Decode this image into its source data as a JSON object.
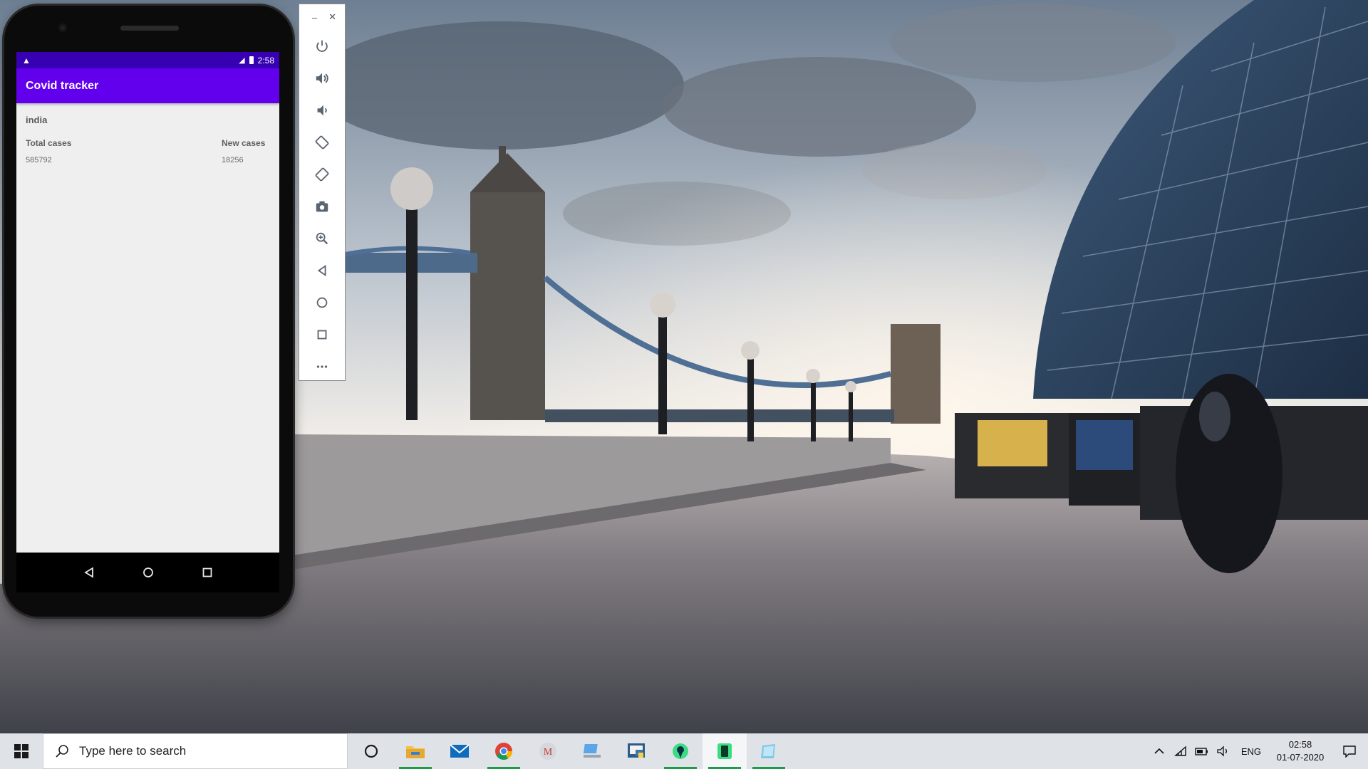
{
  "emulator": {
    "status_bar": {
      "time": "2:58"
    },
    "app": {
      "title": "Covid tracker",
      "country": "india",
      "stats": [
        {
          "label": "Total cases",
          "value": "585792"
        },
        {
          "label": "New cases",
          "value": "18256"
        }
      ]
    },
    "nav_buttons": [
      "back-icon",
      "home-icon",
      "overview-icon"
    ],
    "toolbar": {
      "window_controls": [
        "minimize-icon",
        "close-icon"
      ],
      "buttons": [
        "power-icon",
        "volume-up-icon",
        "volume-down-icon",
        "rotate-left-icon",
        "rotate-right-icon",
        "camera-icon",
        "zoom-icon",
        "back-icon",
        "home-icon",
        "overview-icon",
        "more-icon"
      ]
    }
  },
  "taskbar": {
    "search_placeholder": "Type here to search",
    "pinned_icons": [
      "cortana-icon",
      "file-explorer-icon",
      "mail-icon",
      "chrome-icon",
      "gmail-icon",
      "network-drive-icon",
      "python-icon",
      "android-studio-icon",
      "emulator-icon",
      "notepad-icon"
    ],
    "tray": {
      "language": "ENG",
      "time": "02:58",
      "date": "01-07-2020"
    }
  },
  "colors": {
    "status_bar": "#3700b3",
    "app_bar": "#6200ee",
    "taskbar": "#dfe3e8"
  }
}
